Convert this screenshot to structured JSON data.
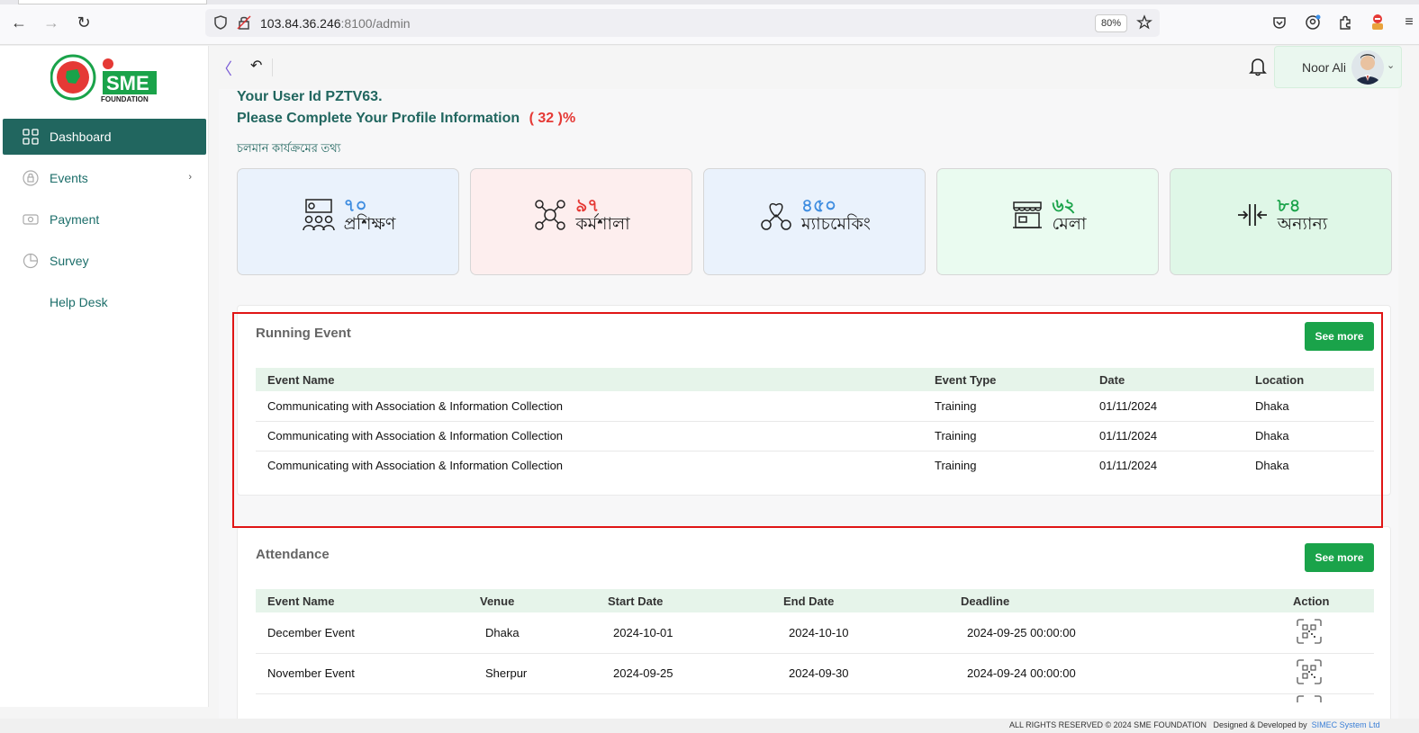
{
  "browser": {
    "url_host": "103.84.36.246",
    "url_rest": ":8100/admin",
    "zoom": "80%"
  },
  "sidebar": {
    "items": [
      {
        "label": "Dashboard",
        "icon": "grid-icon",
        "active": true
      },
      {
        "label": "Events",
        "icon": "lock-icon",
        "has_chevron": true,
        "chevron": "›"
      },
      {
        "label": "Payment",
        "icon": "payment-icon"
      },
      {
        "label": "Survey",
        "icon": "pie-icon"
      },
      {
        "label": "Help Desk",
        "icon": ""
      }
    ]
  },
  "logo": {
    "text": "SME",
    "subtext": "FOUNDATION"
  },
  "topbar": {
    "collapse_glyph": "〈",
    "undo_glyph": "↶",
    "user_name": "Noor Ali"
  },
  "profile": {
    "user_id_line": "Your User Id PZTV63.",
    "complete_line": "Please Complete Your Profile Information",
    "percent": "( 32 )%",
    "running_info": "চলমান কার্যক্রমের তথ্য"
  },
  "stats": [
    {
      "num": "৭০",
      "label": "প্রশিক্ষণ",
      "bg": "#eaf2fc",
      "color": "#3f8de0",
      "icon": "training-icon"
    },
    {
      "num": "৯৭",
      "label": "কর্মশালা",
      "bg": "#fdeeee",
      "color": "#e53935",
      "icon": "workshop-icon"
    },
    {
      "num": "৪৫০",
      "label": "ম্যাচমেকিং",
      "bg": "#eaf2fc",
      "color": "#3f8de0",
      "icon": "matchmaking-icon"
    },
    {
      "num": "৬২",
      "label": "মেলা",
      "bg": "#eafbf0",
      "color": "#1aa34a",
      "icon": "fair-icon"
    },
    {
      "num": "৮৪",
      "label": "অন্যান্য",
      "bg": "#dff7e7",
      "color": "#1aa34a",
      "icon": "others-icon"
    }
  ],
  "running_event": {
    "title": "Running Event",
    "see_more": "See more",
    "columns": [
      "Event Name",
      "Event Type",
      "Date",
      "Location"
    ],
    "rows": [
      [
        "Communicating with Association & Information Collection",
        "Training",
        "01/11/2024",
        "Dhaka"
      ],
      [
        "Communicating with Association & Information Collection",
        "Training",
        "01/11/2024",
        "Dhaka"
      ],
      [
        "Communicating with Association & Information Collection",
        "Training",
        "01/11/2024",
        "Dhaka"
      ]
    ]
  },
  "attendance": {
    "title": "Attendance",
    "see_more": "See more",
    "columns": [
      "Event Name",
      "Venue",
      "Start Date",
      "End Date",
      "Deadline",
      "Action"
    ],
    "rows": [
      [
        "December Event",
        "Dhaka",
        "2024-10-01",
        "2024-10-10",
        "2024-09-25 00:00:00"
      ],
      [
        "November Event",
        "Sherpur",
        "2024-09-25",
        "2024-09-30",
        "2024-09-24 00:00:00"
      ]
    ]
  },
  "footer": {
    "rights": "ALL RIGHTS RESERVED © 2024 SME FOUNDATION",
    "designed": "Designed & Developed by",
    "company": "SIMEC System Ltd"
  }
}
